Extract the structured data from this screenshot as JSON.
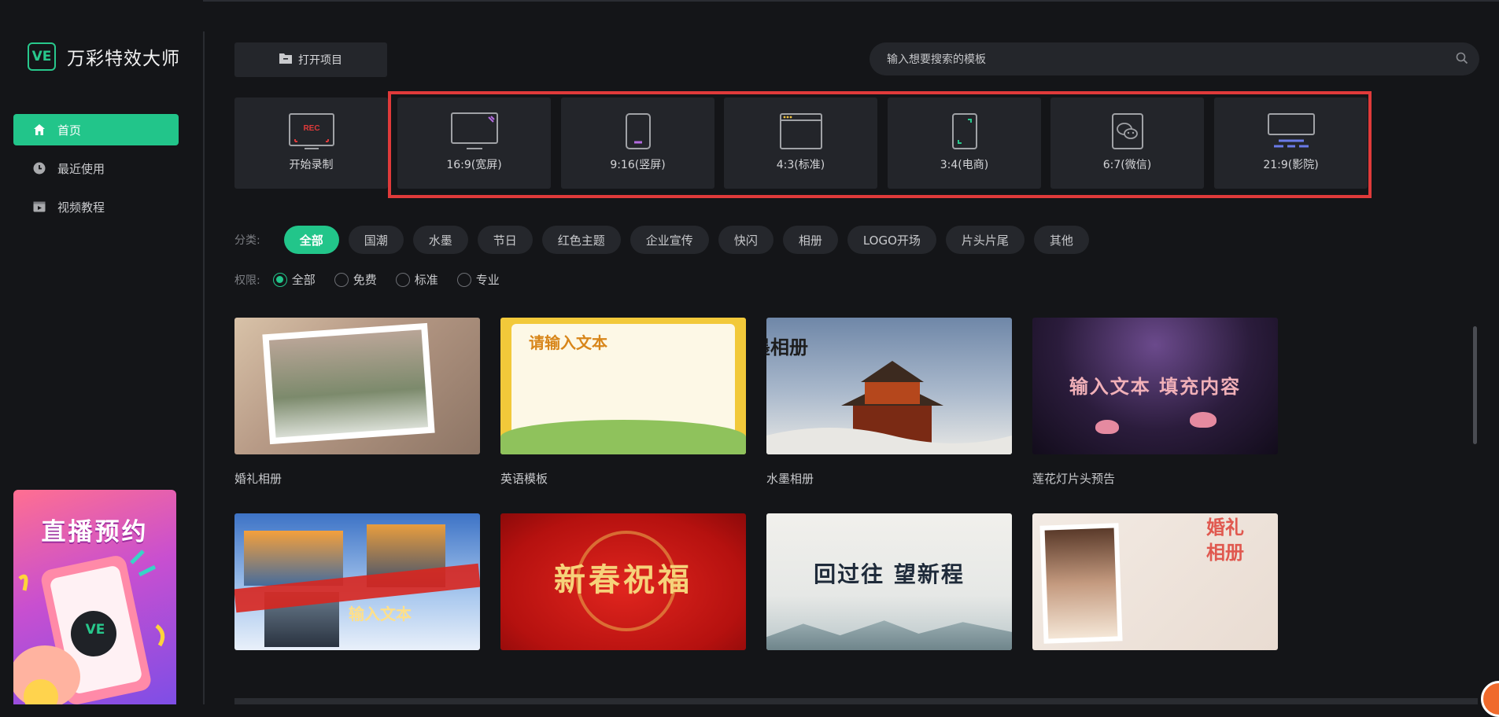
{
  "app": {
    "logo_mark": "VE",
    "name": "万彩特效大师"
  },
  "sidebar": {
    "items": [
      {
        "label": "首页",
        "icon": "home-icon",
        "active": true
      },
      {
        "label": "最近使用",
        "icon": "clock-icon",
        "active": false
      },
      {
        "label": "视频教程",
        "icon": "video-icon",
        "active": false
      }
    ],
    "promo": {
      "title": "直播预约",
      "badge": "VE"
    }
  },
  "toolbar": {
    "open_project": "打开项目"
  },
  "search": {
    "placeholder": "输入想要搜索的模板"
  },
  "ratios": [
    {
      "label": "开始录制",
      "icon": "rec-icon",
      "badge": "REC"
    },
    {
      "label": "16:9(宽屏)",
      "icon": "widescreen-icon"
    },
    {
      "label": "9:16(竖屏)",
      "icon": "portrait-icon"
    },
    {
      "label": "4:3(标准)",
      "icon": "standard-window-icon"
    },
    {
      "label": "3:4(电商)",
      "icon": "ecommerce-icon"
    },
    {
      "label": "6:7(微信)",
      "icon": "wechat-icon"
    },
    {
      "label": "21:9(影院)",
      "icon": "cinema-icon"
    }
  ],
  "filters": {
    "category_label": "分类:",
    "categories": [
      "全部",
      "国潮",
      "水墨",
      "节日",
      "红色主题",
      "企业宣传",
      "快闪",
      "相册",
      "LOGO开场",
      "片头片尾",
      "其他"
    ],
    "active_category": "全部",
    "permission_label": "权限:",
    "permissions": [
      "全部",
      "免费",
      "标准",
      "专业"
    ],
    "active_permission": "全部"
  },
  "templates": [
    {
      "title": "婚礼相册",
      "overlay": ""
    },
    {
      "title": "英语模板",
      "overlay": "请输入文本"
    },
    {
      "title": "水墨相册",
      "overlay": "水墨相册"
    },
    {
      "title": "莲花灯片头预告",
      "overlay": "输入文本 填充内容"
    },
    {
      "title": "",
      "overlay": "输入文本"
    },
    {
      "title": "",
      "overlay": "新春祝福"
    },
    {
      "title": "",
      "overlay": "回过往 望新程"
    },
    {
      "title": "",
      "overlay": "婚礼相册"
    }
  ],
  "colors": {
    "accent": "#22c58a",
    "highlight": "#e03a3a",
    "background": "#141518",
    "card": "#23252a"
  }
}
